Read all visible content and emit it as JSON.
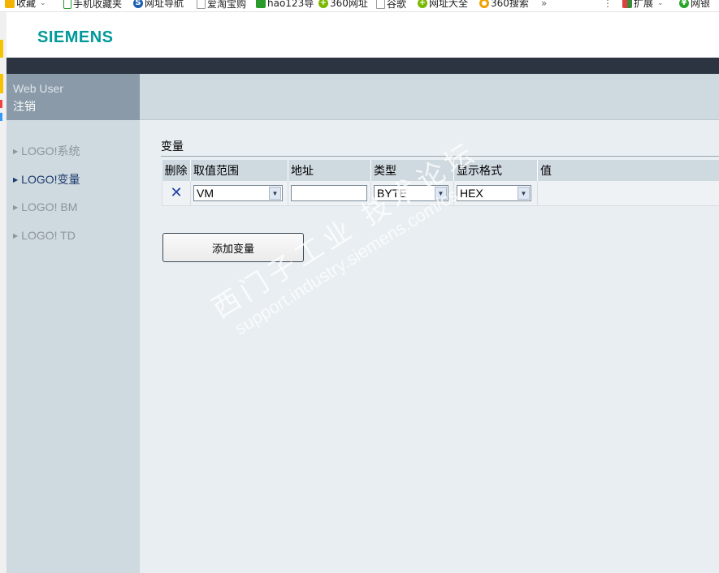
{
  "bookmarks": [
    {
      "label": "收藏",
      "icon": "star-icon",
      "dropdown": true
    },
    {
      "label": "手机收藏夹",
      "icon": "phone-icon"
    },
    {
      "label": "网址导航",
      "icon": "s-logo-icon"
    },
    {
      "label": "爱淘宝购",
      "icon": "doc-icon"
    },
    {
      "label": "hao123导",
      "icon": "hao-icon"
    },
    {
      "label": "360网址",
      "icon": "plus-icon"
    },
    {
      "label": "谷歌",
      "icon": "doc-icon"
    },
    {
      "label": "网址大全",
      "icon": "plus-icon"
    },
    {
      "label": "360搜索",
      "icon": "ring-icon"
    }
  ],
  "bookmarks_more": "»",
  "toolbar_right": {
    "menu": "⋮",
    "extensions_label": "扩展",
    "bank_label": "网银"
  },
  "brand": {
    "logo_text": "SIEMENS",
    "color": "#009999"
  },
  "sidebar": {
    "user_label": "Web User",
    "logout_label": "注销",
    "items": [
      {
        "label": "LOGO!系统",
        "active": false
      },
      {
        "label": "LOGO!变量",
        "active": true
      },
      {
        "label": "LOGO! BM",
        "active": false
      },
      {
        "label": "LOGO! TD",
        "active": false
      }
    ]
  },
  "main": {
    "section_title": "变量",
    "table": {
      "headers": [
        "删除",
        "取值范围",
        "地址",
        "类型",
        "显示格式",
        "值"
      ],
      "rows": [
        {
          "range": "VM",
          "address": "",
          "type": "BYTE",
          "format": "HEX",
          "value": ""
        }
      ]
    },
    "add_button_label": "添加变量"
  },
  "watermark": {
    "line1": "西门子工业 技术论坛",
    "line2": "support.industry.siemens.com/cs"
  }
}
